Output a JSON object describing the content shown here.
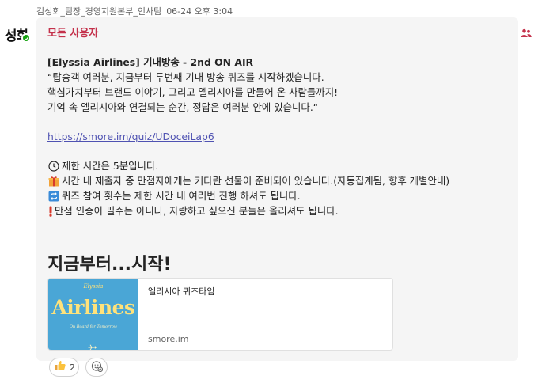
{
  "message": {
    "author": "김성회_팀장_경영지원본부_인사팀",
    "timestamp": "06-24 오후 3:04",
    "avatar_initials": "성회",
    "presence_color": "#13a10e",
    "mention": "모든 사용자",
    "mention_color": "#c4314b",
    "title": "[Elyssia Airlines] 기내방송 - 2nd ON AIR",
    "body": [
      "“탑승객 여러분, 지금부터 두번째 기내 방송 퀴즈를 시작하겠습니다.",
      "핵심가치부터 브랜드 이야기, 그리고 엘리시아를 만들어 온 사람들까지!",
      "기억 속 엘리시아와 연결되는 순간, 정답은 여러분 안에 있습니다.“"
    ],
    "link": "https://smore.im/quiz/UDoceiLap6",
    "link_color": "#4f52b2",
    "rules": [
      {
        "icon": "clock-icon",
        "text": "제한 시간은 5분입니다."
      },
      {
        "icon": "gift-icon",
        "text": "시간 내 제출자 중 만점자에게는 커다란 선물이 준비되어 있습니다.(자동집계됨, 향후 개별안내)"
      },
      {
        "icon": "repeat-icon",
        "text": "퀴즈 참여 횟수는 제한 시간 내 여러번 진행 하셔도 됩니다."
      },
      {
        "icon": "exclamation-icon",
        "text": "만점 인증이 필수는 아니나, 자랑하고 싶으신 분들은 올리셔도 됩니다."
      }
    ],
    "heading": "지금부터...시작!",
    "link_card": {
      "thumbnail_brand": "Elyssia",
      "thumbnail_title": "Airlines",
      "thumbnail_subtitle": "On Board for Tomorrow",
      "title": "엘리시아 퀴즈타임",
      "domain": "smore.im"
    },
    "reactions": [
      {
        "icon": "thumbs-up-icon",
        "count": "2"
      }
    ]
  }
}
